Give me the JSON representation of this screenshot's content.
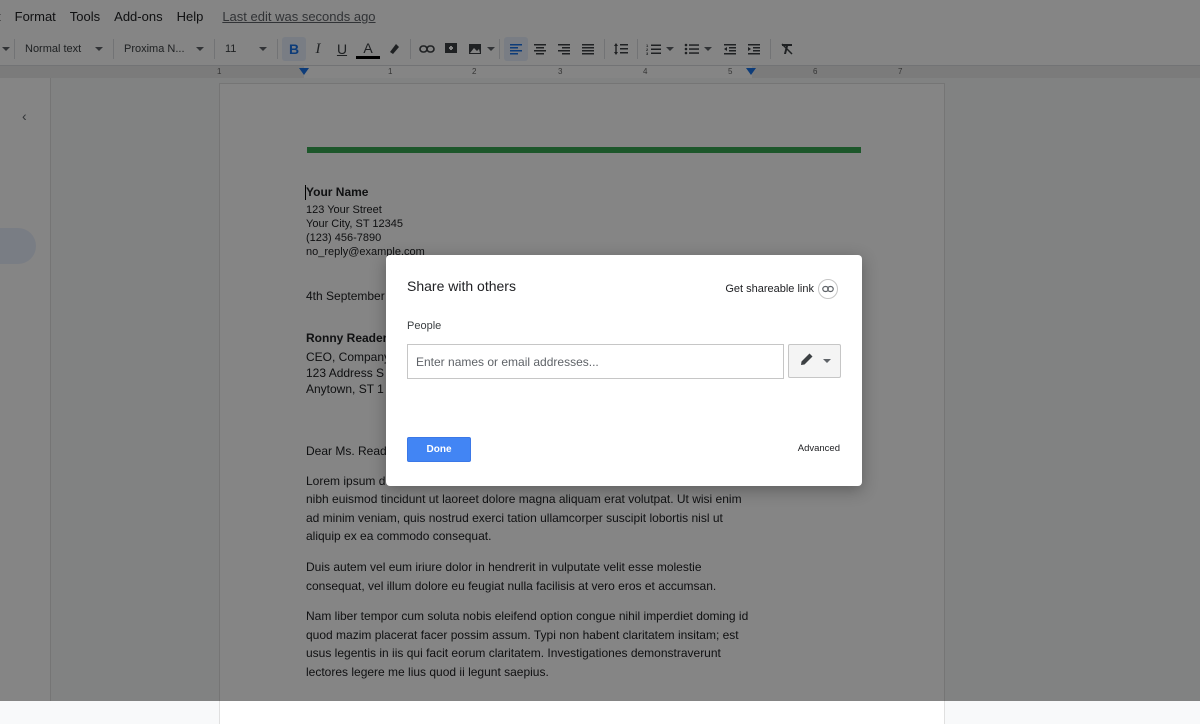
{
  "menu": {
    "items": [
      "t",
      "Format",
      "Tools",
      "Add-ons",
      "Help"
    ],
    "last_edit": "Last edit was seconds ago"
  },
  "toolbar": {
    "style": "Normal text",
    "font": "Proxima N...",
    "size": "11",
    "bold": "B",
    "italic": "I",
    "underline": "U",
    "text_color": "A"
  },
  "ruler": {
    "numbers": [
      "1",
      "1",
      "2",
      "3",
      "4",
      "5",
      "6",
      "7"
    ]
  },
  "document": {
    "name": "Your Name",
    "address_lines": [
      "123 Your Street",
      "Your City, ST 12345",
      "(123) 456-7890",
      "no_reply@example.com"
    ],
    "date": "4th September",
    "recipient_name": "Ronny Reader",
    "recipient_lines": [
      "CEO, Company",
      "123 Address S",
      "Anytown, ST 1"
    ],
    "salutation": "Dear Ms. Reader",
    "p1_first": "Lorem ipsum d",
    "p1_rest": "nibh euismod tincidunt ut laoreet dolore magna aliquam erat volutpat. Ut wisi enim ad minim veniam, quis nostrud exerci tation ullamcorper suscipit lobortis nisl ut aliquip ex ea commodo consequat.",
    "p2": "Duis autem vel eum iriure dolor in hendrerit in vulputate velit esse molestie consequat, vel illum dolore eu feugiat nulla facilisis at vero eros et accumsan.",
    "p3": "Nam liber tempor cum soluta nobis eleifend option congue nihil imperdiet doming id quod mazim placerat facer possim assum. Typi non habent claritatem insitam; est usus legentis in iis qui facit eorum claritatem. Investigationes demonstraverunt lectores legere me lius quod ii legunt saepius."
  },
  "dialog": {
    "title": "Share with others",
    "get_link": "Get shareable link",
    "people_label": "People",
    "input_placeholder": "Enter names or email addresses...",
    "input_value": "",
    "done": "Done",
    "advanced": "Advanced"
  },
  "colors": {
    "accent": "#4285f4",
    "green_bar": "#38a853",
    "overlay": "rgba(0,0,0,0.48)"
  },
  "icons": [
    "link-icon",
    "pencil-icon",
    "chevron-left-icon",
    "caret-down-icon"
  ]
}
